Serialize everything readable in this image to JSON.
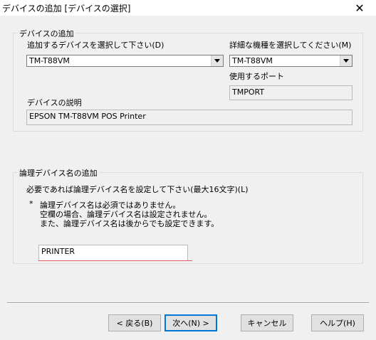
{
  "window": {
    "title": "デバイスの追加 [デバイスの選択]",
    "close_glyph": "✕"
  },
  "device_group": {
    "legend": "デバイスの追加",
    "device_label": "追加するデバイスを選択して下さい(D)",
    "device_value": "TM-T88VM",
    "model_label": "詳細な機種を選択してください(M)",
    "model_value": "TM-T88VM",
    "port_label": "使用するポート",
    "port_value": "TMPORT",
    "description_label": "デバイスの説明",
    "description_value": "EPSON TM-T88VM POS Printer"
  },
  "logical_group": {
    "legend": "論理デバイス名の追加",
    "instruction": "必要であれば論理デバイス名を設定して下さい(最大16文字)(L)",
    "note_bullet": "*",
    "note_lines": [
      "論理デバイス名は必須ではありません。",
      "空欄の場合、論理デバイス名は設定されません。",
      "また、論理デバイス名は後からでも設定できます。"
    ],
    "name_value": "PRINTER"
  },
  "buttons": {
    "back": "< 戻る(B)",
    "next": "次へ(N) >",
    "cancel": "キャンセル",
    "help": "ヘルプ(H)"
  },
  "icons": {
    "combo_arrow": "chevron-down-icon",
    "close": "close-icon"
  },
  "colors": {
    "background": "#f0f0f0",
    "titlebar": "#ffffff",
    "default_button_border": "#0078d7",
    "input_underline": "#e06060"
  }
}
